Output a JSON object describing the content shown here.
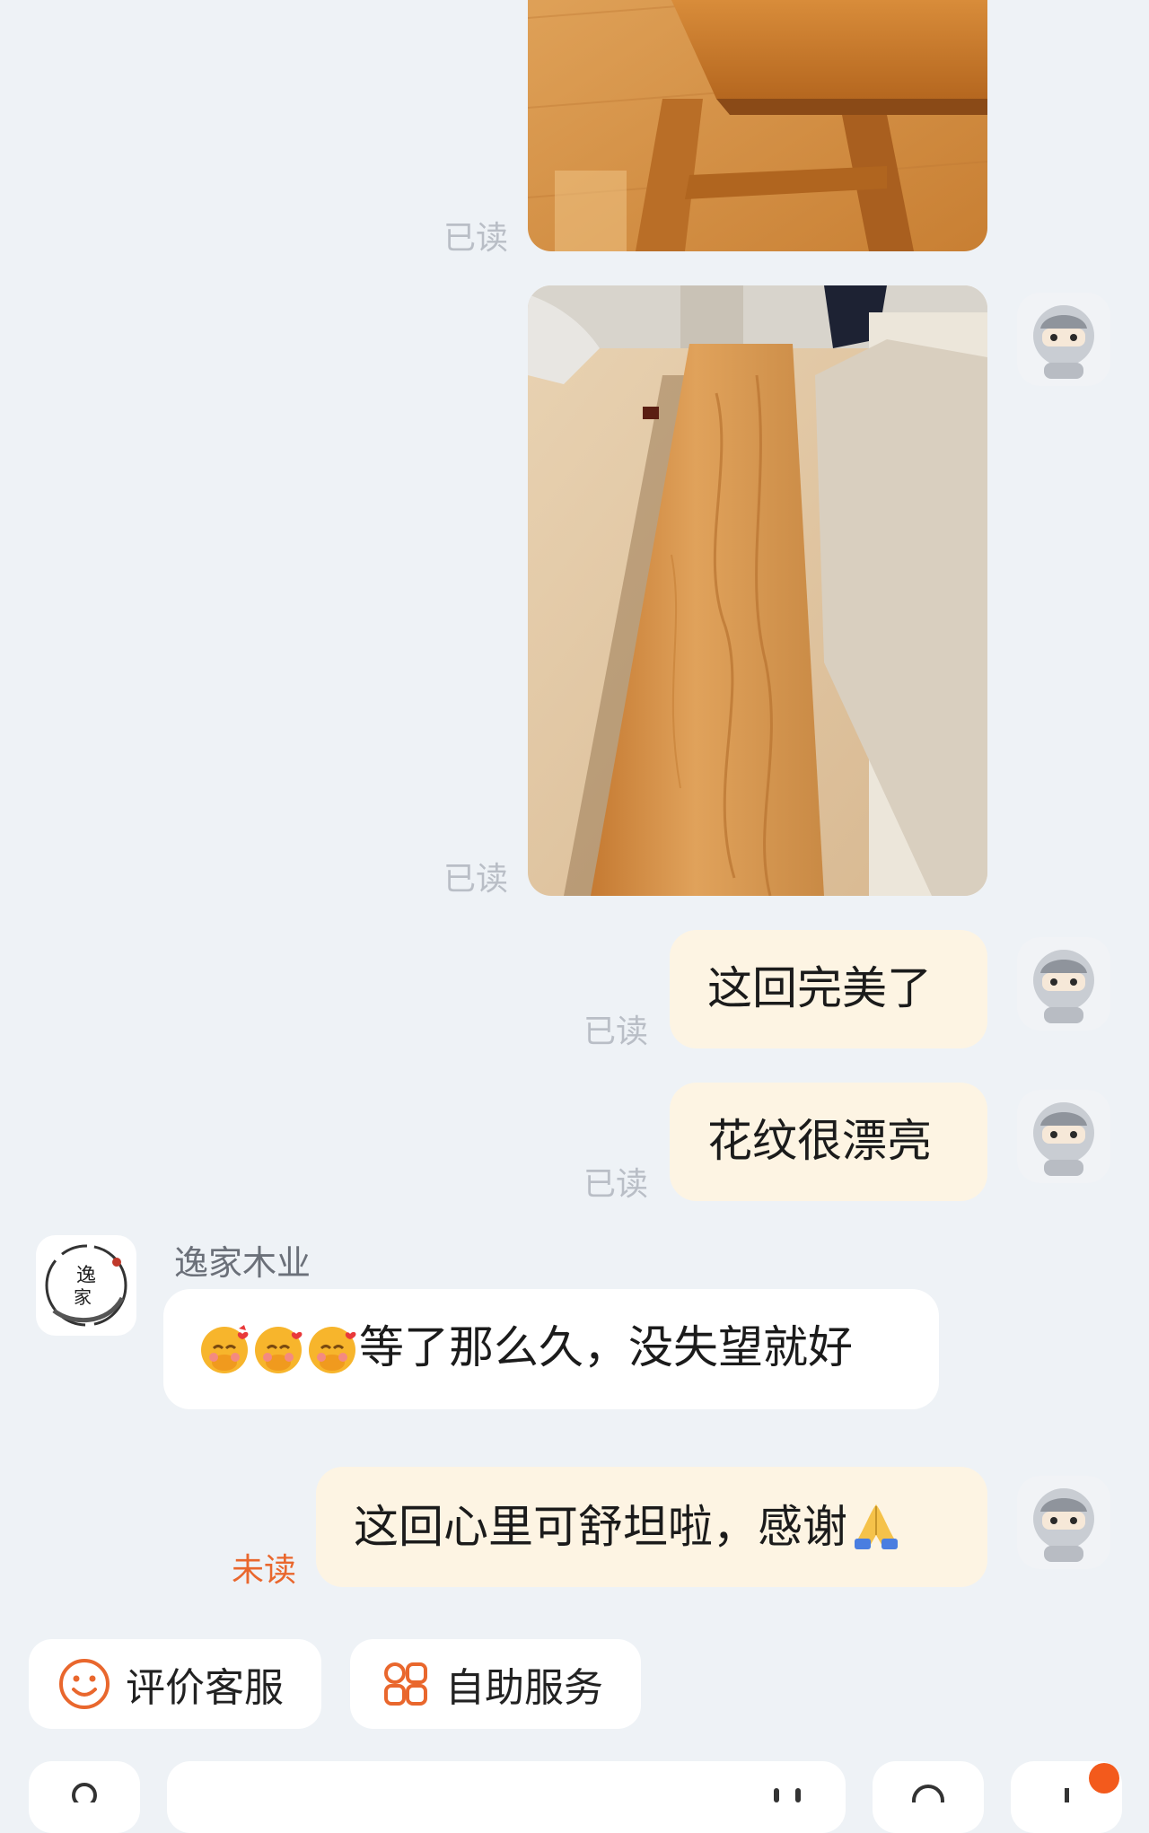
{
  "status_read": "已读",
  "status_unread": "未读",
  "messages": {
    "m1": "这回完美了",
    "m2": "花纹很漂亮",
    "m3": "等了那么久，没失望就好",
    "m4": "这回心里可舒坦啦，感谢"
  },
  "store": {
    "name": "逸家木业",
    "logo_text": "逸家"
  },
  "quick_actions": {
    "rate_service": "评价客服",
    "self_service": "自助服务"
  },
  "colors": {
    "page_bg": "#eef2f6",
    "bubble_self": "#fdf4e3",
    "bubble_other": "#ffffff",
    "accent_orange": "#e9672d",
    "read_gray": "#b9bec6"
  },
  "icons": [
    "smile-icon",
    "apps-icon",
    "voice-icon",
    "emoji-icon",
    "plus-icon",
    "blush-emoji",
    "pray-emoji"
  ]
}
